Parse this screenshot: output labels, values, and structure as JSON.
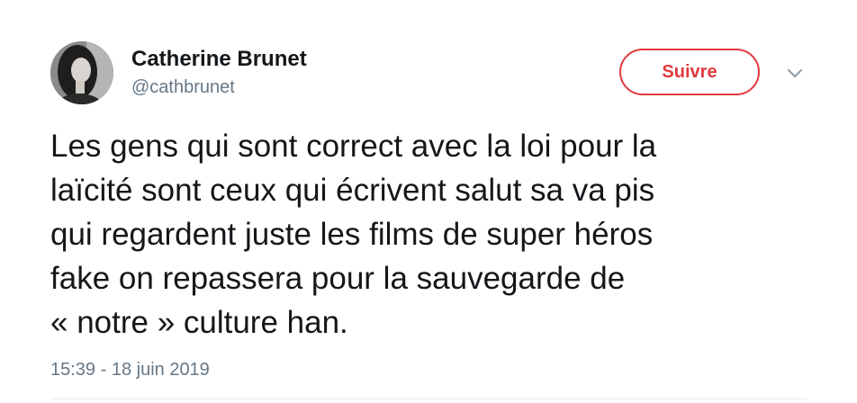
{
  "author": {
    "display_name": "Catherine Brunet",
    "handle": "@cathbrunet"
  },
  "follow_button": {
    "label": "Suivre",
    "color": "#e0393e"
  },
  "tweet": {
    "lines": [
      "Les gens qui sont correct avec la loi pour la",
      "laïcité sont ceux qui écrivent salut sa va pis",
      "qui regardent juste les films de super héros",
      "fake on repassera pour la sauvegarde de",
      "« notre » culture han."
    ],
    "timestamp": "15:39 - 18 juin 2019"
  },
  "icons": {
    "avatar": "profile-photo",
    "caret": "chevron-down-icon"
  }
}
